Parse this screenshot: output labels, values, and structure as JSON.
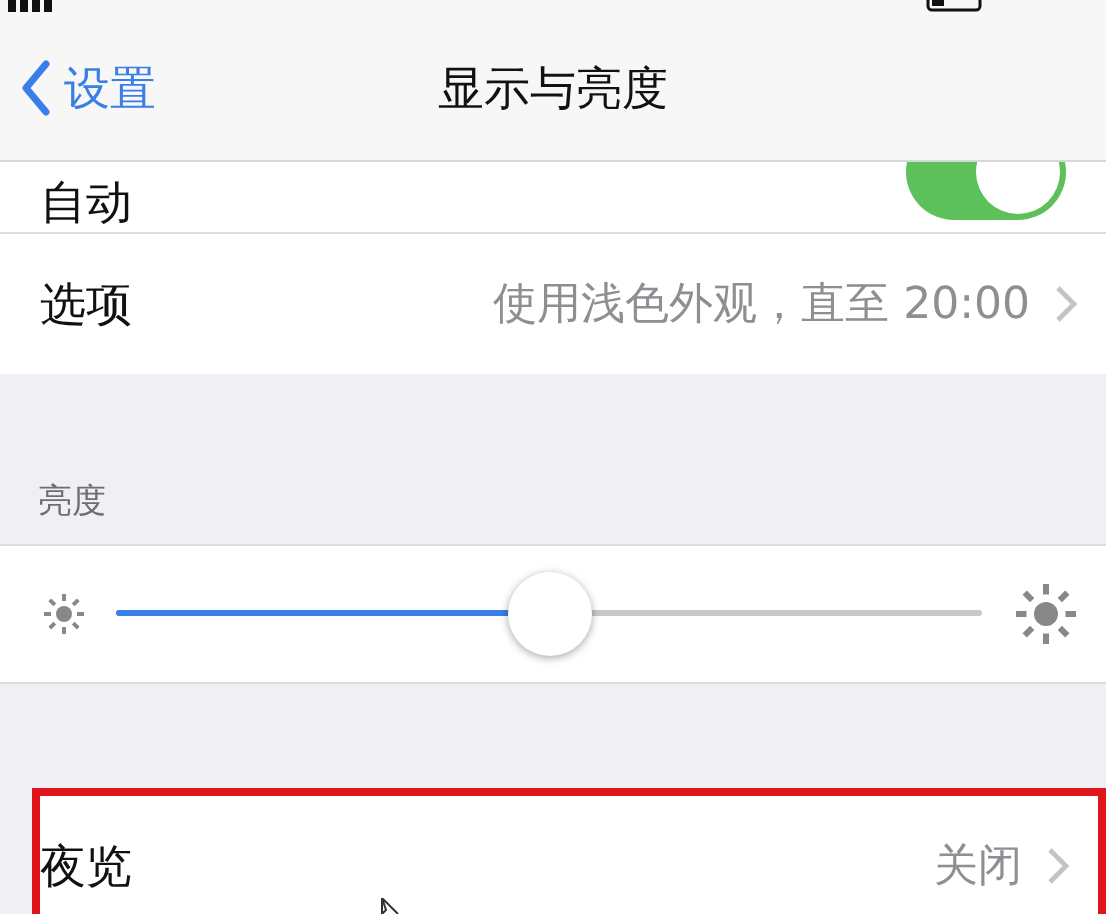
{
  "nav": {
    "back": "设置",
    "title": "显示与亮度"
  },
  "appearance_rows": [
    {
      "kind": "toggle",
      "label": "自动",
      "on": true
    },
    {
      "kind": "link",
      "label": "选项",
      "value": "使用浅色外观，直至 20:00"
    }
  ],
  "brightness": {
    "header": "亮度",
    "level": 0.5
  },
  "night_shift": {
    "label": "夜览",
    "value": "关闭",
    "highlighted": true
  }
}
